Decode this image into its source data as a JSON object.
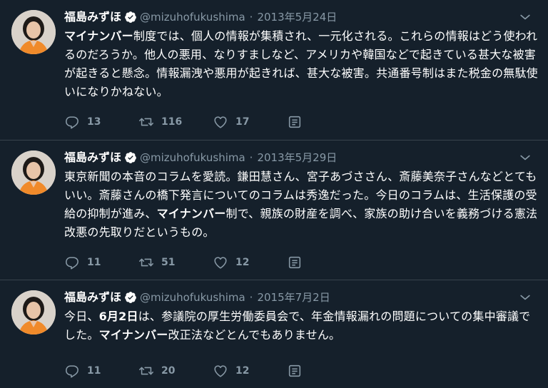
{
  "colors": {
    "background": "#15202b",
    "text": "#ffffff",
    "muted": "#8899a6",
    "divider": "#38444d",
    "verified_badge": "#ffffff"
  },
  "tweets": [
    {
      "author_name": "福島みずほ",
      "handle": "@mizuhofukushima",
      "separator": "·",
      "date": "2013年5月24日",
      "body_parts": [
        {
          "text": "マイナンバー",
          "bold": true
        },
        {
          "text": "制度では、個人の情報が集積され、一元化される。これらの情報はどう使われるのだろうか。他人の悪用、なりすましなど、アメリカや韓国などで起きている甚大な被害が起きると懸念。情報漏洩や悪用が起きれば、甚大な被害。共通番号制はまた税金の無駄使いになりかねない。",
          "bold": false
        }
      ],
      "reply_count": "13",
      "retweet_count": "116",
      "like_count": "17"
    },
    {
      "author_name": "福島みずほ",
      "handle": "@mizuhofukushima",
      "separator": "·",
      "date": "2013年5月29日",
      "body_parts": [
        {
          "text": "東京新聞の本音のコラムを愛読。鎌田慧さん、宮子あづささん、斎藤美奈子さんなどとてもいい。斎藤さんの橋下発言についてのコラムは秀逸だった。今日のコラムは、生活保護の受給の抑制が進み、",
          "bold": false
        },
        {
          "text": "マイナンバー",
          "bold": true
        },
        {
          "text": "制で、親族の財産を調べ、家族の助け合いを義務づける憲法改悪の先取りだというもの。",
          "bold": false
        }
      ],
      "reply_count": "11",
      "retweet_count": "51",
      "like_count": "12"
    },
    {
      "author_name": "福島みずほ",
      "handle": "@mizuhofukushima",
      "separator": "·",
      "date": "2015年7月2日",
      "body_parts": [
        {
          "text": "今日、",
          "bold": false
        },
        {
          "text": "6月2日",
          "bold": true
        },
        {
          "text": "は、参議院の厚生労働委員会で、年金情報漏れの問題についての集中審議でした。",
          "bold": false
        },
        {
          "text": "マイナンバー",
          "bold": true
        },
        {
          "text": "改正法などとんでもありません。",
          "bold": false
        }
      ],
      "reply_count": "11",
      "retweet_count": "20",
      "like_count": "12"
    }
  ]
}
